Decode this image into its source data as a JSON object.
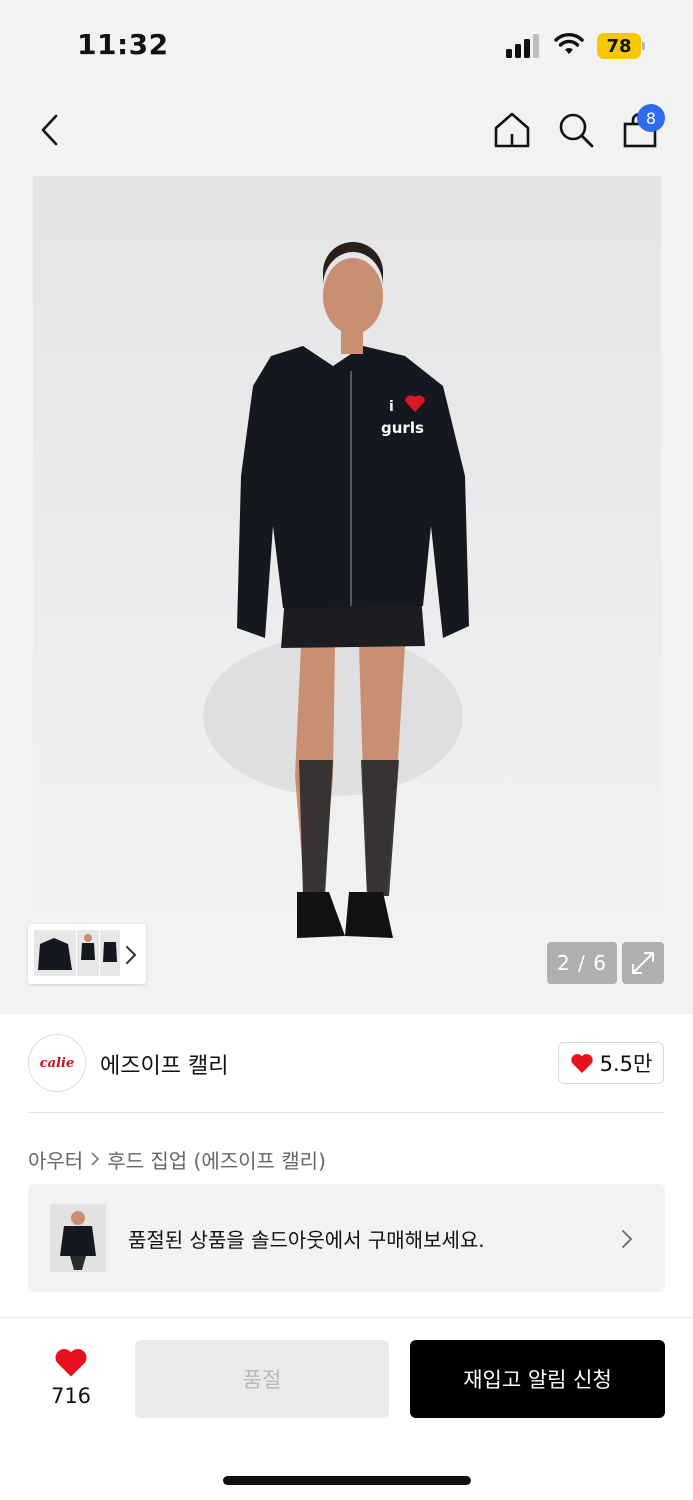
{
  "status_bar": {
    "time": "11:32",
    "battery": "78",
    "battery_color": "#f5c800"
  },
  "nav": {
    "back_icon": "chevron-left-icon",
    "home_icon": "home-icon",
    "search_icon": "search-icon",
    "cart_icon": "shopping-bag-icon",
    "cart_count": "8",
    "badge_color": "#2e6bf0"
  },
  "gallery": {
    "counter": "2 / 6",
    "expand_icon": "expand-arrows-icon",
    "thumb_next_icon": "chevron-right-icon"
  },
  "brand": {
    "name": "에즈이프 캘리",
    "logo_text": "calie",
    "likes": "5.5만",
    "heart_color": "#e8101c"
  },
  "breadcrumb": {
    "category": "아우터",
    "subcategory": "후드 집업 (에즈이프 캘리)"
  },
  "soldout_banner": {
    "text": "품절된 상품을 솔드아웃에서 구매해보세요."
  },
  "bottom_bar": {
    "wish_count": "716",
    "soldout_label": "품절",
    "restock_label": "재입고 알림 신청"
  }
}
